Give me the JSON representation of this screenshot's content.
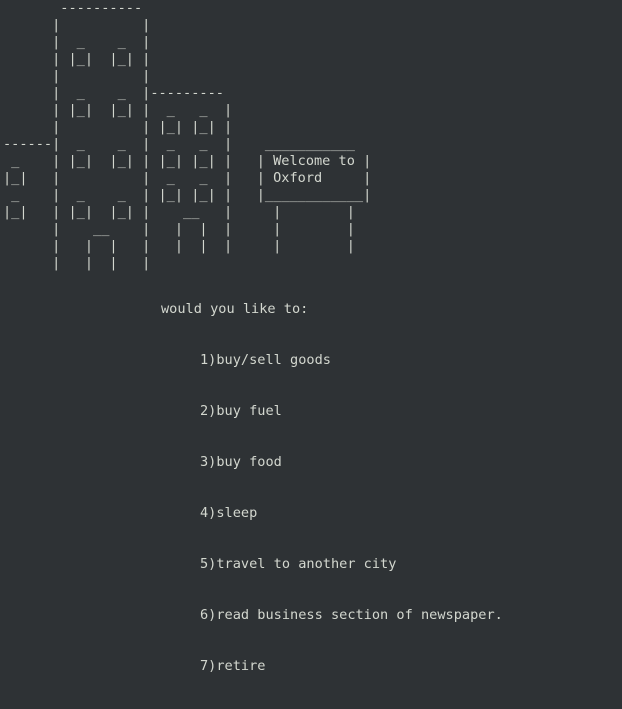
{
  "city_art": "       ----------\n      |          |\n      |  _    _  |\n      | |_|  |_| |\n      |          |\n      |  _    _  |---------\n      | |_|  |_| |  _   _  |\n      |          | |_| |_| |\n------|  _    _  |  _   _  |    ___________\n _    | |_|  |_| | |_| |_| |   | Welcome to |\n|_|   |          |  _   _  |   | Oxford     |\n _    |  _    _  | |_| |_| |   |____________|\n|_|   | |_|  |_| |    __   |     |        |\n      |    __    |   |  |  |     |        |\n      |   |  |   |   |  |  |     |        |\n      |   |  |   |",
  "menu": {
    "prompt": "would you like to:",
    "options": [
      "1)buy/sell goods",
      "2)buy fuel",
      "3)buy food",
      "4)sleep",
      "5)travel to another city",
      "6)read business section of newspaper.",
      "7)retire"
    ]
  }
}
